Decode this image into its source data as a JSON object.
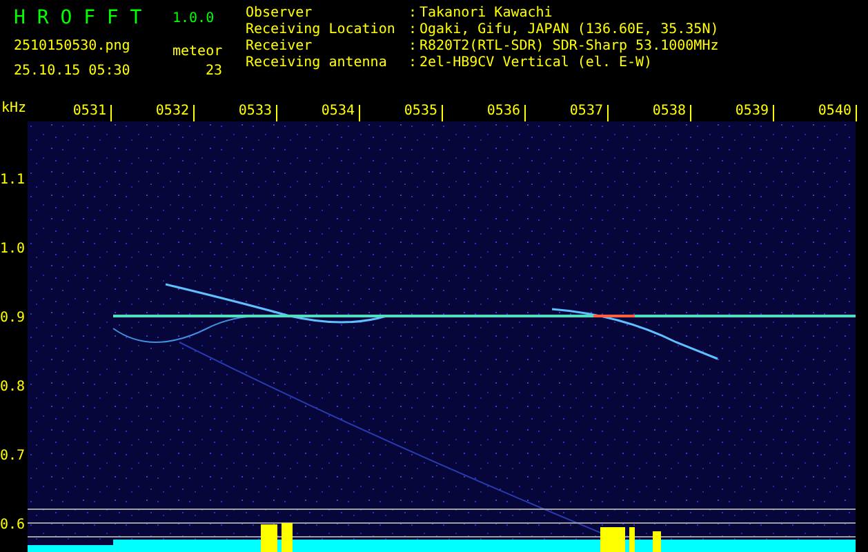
{
  "app": {
    "title": "H R O F F T",
    "version": "1.0.0"
  },
  "file_name": "2510150530.png",
  "timestamp": "25.10.15 05:30",
  "meteor": {
    "label": "meteor",
    "count": "23"
  },
  "station": [
    {
      "label": "Observer",
      "separator": ":",
      "value": "Takanori Kawachi"
    },
    {
      "label": "Receiving Location",
      "separator": ":",
      "value": "Ogaki, Gifu, JAPAN (136.60E, 35.35N)"
    },
    {
      "label": "Receiver",
      "separator": ":",
      "value": "R820T2(RTL-SDR) SDR-Sharp 53.1000MHz"
    },
    {
      "label": "Receiving antenna",
      "separator": ":",
      "value": "2el-HB9CV Vertical (el. E-W)"
    }
  ],
  "axis": {
    "unit": "kHz",
    "time_labels": [
      "0531",
      "0532",
      "0533",
      "0534",
      "0535",
      "0536",
      "0537",
      "0538",
      "0539",
      "0540"
    ],
    "freq_labels": [
      "1.1",
      "1.0",
      "0.9",
      "0.8",
      "0.7",
      "0.6"
    ]
  }
}
